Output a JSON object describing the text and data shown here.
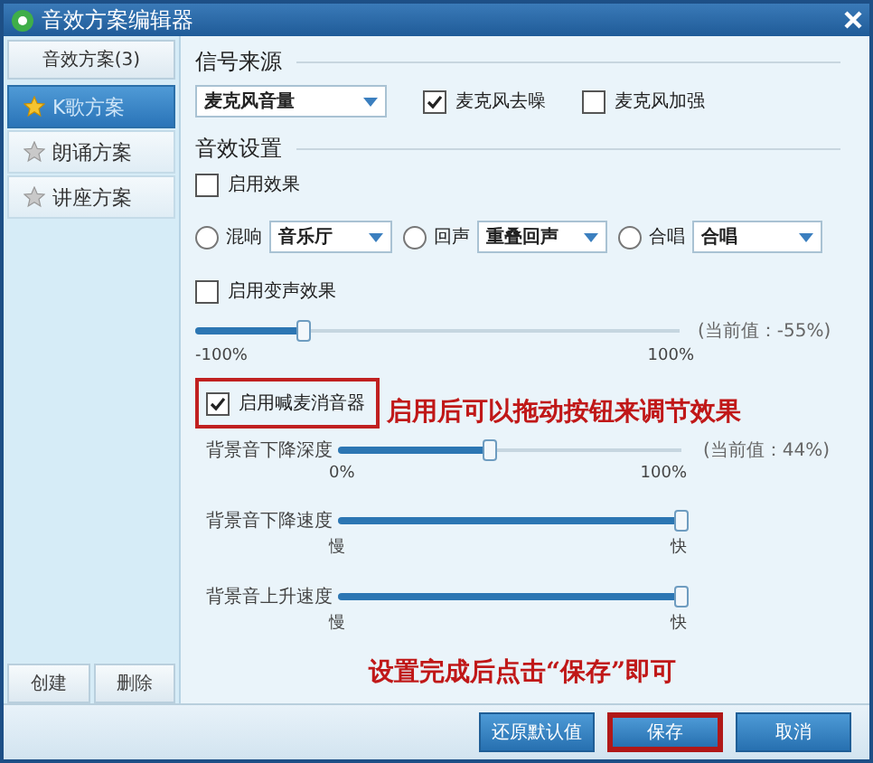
{
  "window": {
    "title": "音效方案编辑器"
  },
  "sidebar": {
    "header": "音效方案(3)",
    "items": [
      {
        "label": "K歌方案",
        "selected": true
      },
      {
        "label": "朗诵方案",
        "selected": false
      },
      {
        "label": "讲座方案",
        "selected": false
      }
    ],
    "buttons": [
      "创建",
      "删除"
    ]
  },
  "signal_source": {
    "heading": "信号来源",
    "dropdown": {
      "value": "麦克风音量"
    },
    "checkboxes": [
      {
        "label": "麦克风去噪",
        "checked": true
      },
      {
        "label": "麦克风加强",
        "checked": false
      }
    ]
  },
  "effects": {
    "heading": "音效设置",
    "enable_effect": {
      "label": "启用效果",
      "checked": false
    },
    "modes": [
      {
        "label": "混响",
        "selected": false,
        "value": "音乐厅"
      },
      {
        "label": "回声",
        "selected": false,
        "value": "重叠回声"
      },
      {
        "label": "合唱",
        "selected": false,
        "value": "合唱"
      }
    ],
    "voice_change": {
      "label": "启用变声效果",
      "checked": false
    },
    "voice_slider": {
      "level": 0.225,
      "reading": "(当前值：-55%)",
      "min_label": "-100%",
      "max_label": "100%"
    }
  },
  "mic_silencer": {
    "checkbox": {
      "label": "启用喊麦消音器",
      "checked": true,
      "highlighted": true
    },
    "annotation": "启用后可以拖动按钮来调节效果",
    "sliders": [
      {
        "label": "背景音下降深度",
        "level": 0.44,
        "reading": "(当前值：44%)",
        "min_label": "0%",
        "max_label": "100%"
      },
      {
        "label": "背景音下降速度",
        "level": 1,
        "min_label": "慢",
        "max_label": "快"
      },
      {
        "label": "背景音上升速度",
        "level": 1,
        "min_label": "慢",
        "max_label": "快"
      }
    ]
  },
  "footer_annotation": "设置完成后点击“保存”即可",
  "footer": {
    "buttons": [
      {
        "label": "还原默认值",
        "highlighted": false
      },
      {
        "label": "保存",
        "highlighted": true
      },
      {
        "label": "取消",
        "highlighted": false
      }
    ]
  }
}
